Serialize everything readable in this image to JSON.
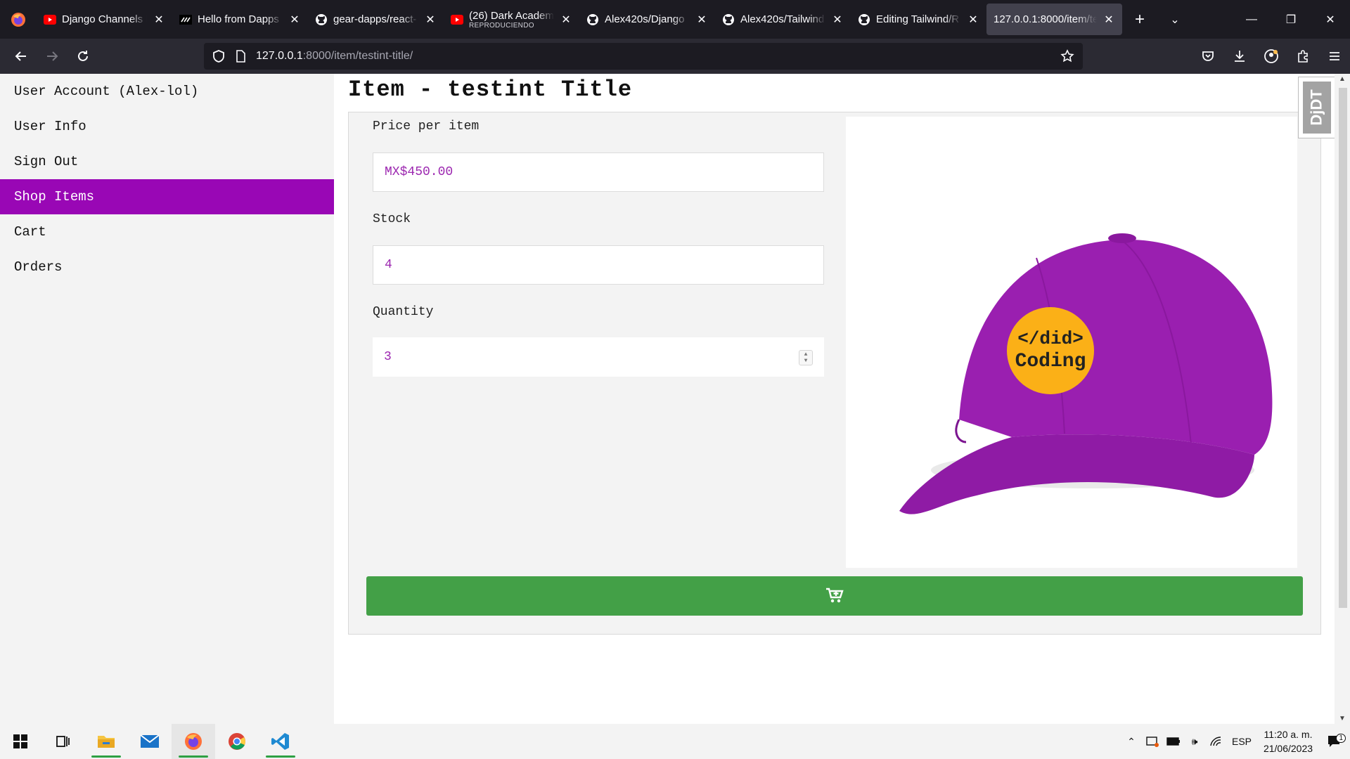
{
  "browser": {
    "tabs": [
      {
        "title": "Django Channels F",
        "favicon": "youtube-icon",
        "active": false
      },
      {
        "title": "Hello from Dapps",
        "favicon": "dapps-icon",
        "active": false
      },
      {
        "title": "gear-dapps/react-",
        "favicon": "github-icon",
        "active": false
      },
      {
        "title": "(26) Dark Academ",
        "subtitle": "REPRODUCIENDO",
        "favicon": "youtube-icon",
        "active": false
      },
      {
        "title": "Alex420s/Django",
        "favicon": "github-icon",
        "active": false
      },
      {
        "title": "Alex420s/Tailwind",
        "favicon": "github-icon",
        "active": false
      },
      {
        "title": "Editing Tailwind/R",
        "favicon": "github-icon",
        "active": false
      },
      {
        "title": "127.0.0.1:8000/item/te",
        "favicon": "",
        "active": true
      }
    ],
    "url": {
      "host": "127.0.0.1",
      "rest": ":8000/item/testint-title/"
    }
  },
  "sidebar": {
    "items": [
      {
        "label": "User Account (Alex-lol)",
        "active": false
      },
      {
        "label": "User Info",
        "active": false
      },
      {
        "label": "Sign Out",
        "active": false
      },
      {
        "label": "Shop Items",
        "active": true
      },
      {
        "label": "Cart",
        "active": false
      },
      {
        "label": "Orders",
        "active": false
      }
    ]
  },
  "page": {
    "title": "Item - testint Title",
    "price_label": "Price per item",
    "price_value": "MX$450.00",
    "stock_label": "Stock",
    "stock_value": "4",
    "quantity_label": "Quantity",
    "quantity_value": "3",
    "image_logo_line1": "</did>",
    "image_logo_line2": "Coding",
    "add_to_cart_icon": "cart-plus-icon"
  },
  "debug_toolbar": {
    "label": "DjDT"
  },
  "taskbar": {
    "language": "ESP",
    "time": "11:20 a. m.",
    "date": "21/06/2023",
    "notifications": "1"
  },
  "colors": {
    "accent": "#9907b5",
    "field_text": "#9c27b0",
    "button": "#43a047",
    "cap": "#9a1fb0",
    "logo_bg": "#fbb017"
  }
}
